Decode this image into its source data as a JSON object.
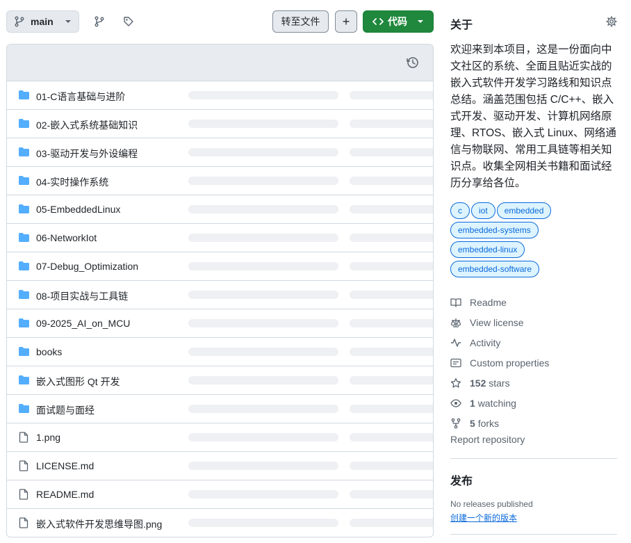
{
  "toolbar": {
    "branch_label": "main",
    "goto_file_label": "转至文件",
    "add_label": "+",
    "code_label": "代码"
  },
  "files": [
    {
      "name": "01-C语言基础与进阶",
      "type": "folder"
    },
    {
      "name": "02-嵌入式系统基础知识",
      "type": "folder"
    },
    {
      "name": "03-驱动开发与外设编程",
      "type": "folder"
    },
    {
      "name": "04-实时操作系统",
      "type": "folder"
    },
    {
      "name": "05-EmbeddedLinux",
      "type": "folder"
    },
    {
      "name": "06-NetworkIot",
      "type": "folder"
    },
    {
      "name": "07-Debug_Optimization",
      "type": "folder"
    },
    {
      "name": "08-项目实战与工具链",
      "type": "folder"
    },
    {
      "name": "09-2025_AI_on_MCU",
      "type": "folder"
    },
    {
      "name": "books",
      "type": "folder"
    },
    {
      "name": "嵌入式图形 Qt 开发",
      "type": "folder"
    },
    {
      "name": "面试题与面经",
      "type": "folder"
    },
    {
      "name": "1.png",
      "type": "file"
    },
    {
      "name": "LICENSE.md",
      "type": "file"
    },
    {
      "name": "README.md",
      "type": "file"
    },
    {
      "name": "嵌入式软件开发思维导图.png",
      "type": "file"
    }
  ],
  "sidebar": {
    "about_title": "关于",
    "description": "欢迎来到本项目，这是一份面向中文社区的系统、全面且贴近实战的嵌入式软件开发学习路线和知识点总结。涵盖范围包括 C/C++、嵌入式开发、驱动开发、计算机网络原理、RTOS、嵌入式 Linux、网络通信与物联网、常用工具链等相关知识点。收集全网相关书籍和面试经历分享给各位。",
    "topics": [
      "c",
      "iot",
      "embedded",
      "embedded-systems",
      "embedded-linux",
      "embedded-software"
    ],
    "readme": "Readme",
    "license": "View license",
    "activity": "Activity",
    "custom_properties": "Custom properties",
    "stars_count": "152",
    "stars_label": "stars",
    "watching_count": "1",
    "watching_label": "watching",
    "forks_count": "5",
    "forks_label": "forks",
    "report": "Report repository",
    "releases_title": "发布",
    "no_releases": "No releases published",
    "create_release": "创建一个新的版本"
  },
  "colors": {
    "folder": "#54aeff",
    "code_button": "#1f883d",
    "topic_bg": "#ddf4ff",
    "link": "#0969da"
  }
}
